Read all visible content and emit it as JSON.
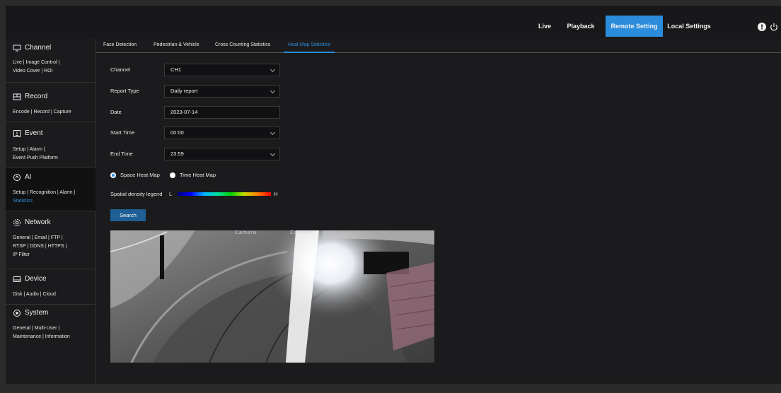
{
  "topbar": {
    "nav": [
      "Live",
      "Playback",
      "Remote Setting",
      "Local Settings"
    ],
    "active": "Remote Setting",
    "icons": [
      "info-icon",
      "power-icon"
    ]
  },
  "sidebar": {
    "channel": {
      "title": "Channel",
      "links1": "Live | Image Control |",
      "links2": "Video Cover | ROI"
    },
    "record": {
      "title": "Record",
      "links1": "Encode | Record | Capture"
    },
    "event": {
      "title": "Event",
      "links1": "Setup | Alarm |",
      "links2": "Event Push Platform"
    },
    "ai": {
      "title": "AI",
      "links1": "Setup | Recognition | Alarm |",
      "links2": "Statistics"
    },
    "network": {
      "title": "Network",
      "links1": "General | Email | FTP |",
      "links2": "RTSP | DDNS | HTTPS |",
      "links3": "IP Filter"
    },
    "device": {
      "title": "Device",
      "links1": "Disk | Audio | Cloud"
    },
    "system": {
      "title": "System",
      "links1": "General | Multi-User |",
      "links2": "Maintenance | Information"
    }
  },
  "tabs": [
    "Face Detection",
    "Pedestrian & Vehicle",
    "Cross Counting Statistics",
    "Heat Map Statistics"
  ],
  "active_tab": "Heat Map Statistics",
  "form": {
    "channel_label": "Channel",
    "channel_value": "CH1",
    "report_label": "Report Type",
    "report_value": "Daily report",
    "date_label": "Date",
    "date_value": "2023-07-14",
    "start_label": "Start Time",
    "start_value": "00:00",
    "end_label": "End Time",
    "end_value": "23:59",
    "radio_space": "Space Heat Map",
    "radio_time": "Time Heat Map",
    "radio_selected": "Space Heat Map",
    "legend_label": "Spatial density legend",
    "legend_low": "L",
    "legend_high": "H",
    "search_label": "Search"
  },
  "image": {
    "overlay_text1": "Camera",
    "overlay_text2": "Camera"
  },
  "colors": {
    "accent": "#2b8cdc",
    "button": "#1f5f96",
    "background": "#1b1b1d"
  }
}
